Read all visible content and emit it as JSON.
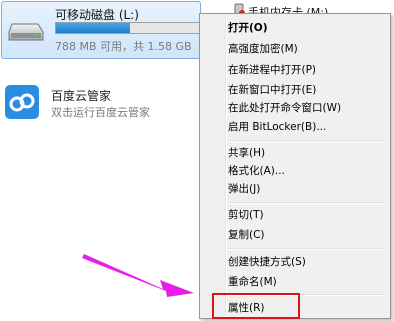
{
  "drive": {
    "name": "可移动磁盘 (L:)",
    "usage_fraction": 0.5,
    "size_text": "788 MB 可用，共 1.58 GB"
  },
  "phone": {
    "name": "手机内存卡 (M:)"
  },
  "cloud_app": {
    "title": "百度云管家",
    "subtitle": "双击运行百度云管家"
  },
  "context_menu": {
    "open": "打开(O)",
    "encrypt": "高强度加密(M)",
    "open_new_process": "在新进程中打开(P)",
    "open_new_window": "在新窗口中打开(E)",
    "open_cmd_here": "在此处打开命令窗口(W)",
    "bitlocker": "启用 BitLocker(B)...",
    "share": "共享(H)",
    "format": "格式化(A)...",
    "eject": "弹出(J)",
    "cut": "剪切(T)",
    "copy": "复制(C)",
    "create_shortcut": "创建快捷方式(S)",
    "rename": "重命名(M)",
    "properties": "属性(R)"
  },
  "colors": {
    "highlight_border": "#e0111b",
    "arrow": "#e81ee8",
    "usage_bar": "#1f7fcf"
  }
}
